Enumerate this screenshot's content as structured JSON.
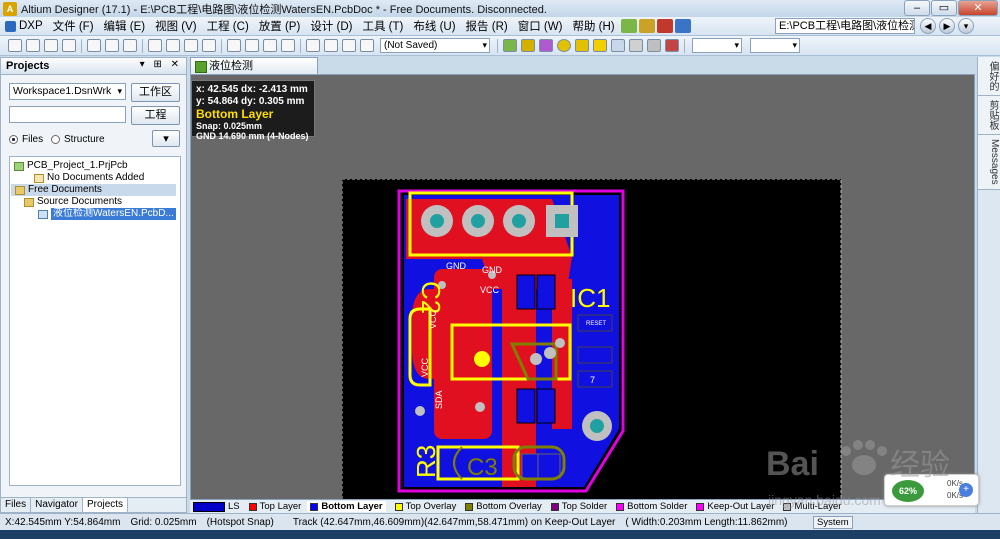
{
  "window": {
    "title": "Altium Designer (17.1) - E:\\PCB工程\\电路图\\液位检测WatersEN.PcbDoc * - Free Documents. Disconnected.",
    "path": "E:\\PCB工程\\电路图\\液位检测Wat"
  },
  "menu": [
    "DXP",
    "文件 (F)",
    "编辑 (E)",
    "视图 (V)",
    "工程 (C)",
    "放置 (P)",
    "设计 (D)",
    "工具 (T)",
    "布线 (U)",
    "报告 (R)",
    "窗口 (W)",
    "帮助 (H)"
  ],
  "toolbar": {
    "saved_combo": "(Not Saved)"
  },
  "projects_panel": {
    "title": "Projects",
    "workspace": "Workspace1.DsnWrk",
    "workspace_btn": "工作区",
    "project_btn": "工程",
    "radio_files": "Files",
    "radio_structure": "Structure",
    "tree": {
      "project": "PCB_Project_1.PrjPcb",
      "no_docs": "No Documents Added",
      "free_docs": "Free Documents",
      "source_docs": "Source Documents",
      "pcb_doc": "液位检测WatersEN.PcbD..."
    },
    "tabs": [
      "Files",
      "Navigator",
      "Projects"
    ]
  },
  "document_tab": "液位检测WatersEN.PcbDoc *",
  "hud": {
    "line1": "x: 42.545   dx: -2.413 mm",
    "line2": "y: 54.864   dy:  0.305 mm",
    "layer": "Bottom Layer",
    "snap": "Snap: 0.025mm",
    "net": "GND   14.690 mm  (4-Nodes)"
  },
  "right_dock": [
    "偏好的",
    "剪贴板",
    "Messages"
  ],
  "layers": [
    {
      "name": "LS",
      "color": "#0000c8"
    },
    {
      "name": "Top Layer",
      "color": "#ff0000"
    },
    {
      "name": "Bottom Layer",
      "color": "#0000ff"
    },
    {
      "name": "Top Overlay",
      "color": "#ffff00"
    },
    {
      "name": "Bottom Overlay",
      "color": "#808000"
    },
    {
      "name": "Top Solder",
      "color": "#800080"
    },
    {
      "name": "Bottom Solder",
      "color": "#ff00ff"
    },
    {
      "name": "Keep-Out Layer",
      "color": "#ff00ff"
    },
    {
      "name": "Multi-Layer",
      "color": "#c0c0c0"
    }
  ],
  "status": {
    "coords": "X:42.545mm Y:54.864mm",
    "grid": "Grid: 0.025mm",
    "snap": "(Hotspot Snap)",
    "track": "Track (42.647mm,46.609mm)(42.647mm,58.471mm) on Keep-Out Layer",
    "width": "( Width:0.203mm Length:11.862mm)",
    "system": "System"
  },
  "net_widget": {
    "pct": "62%",
    "up": "0K/s",
    "down": "0K/s"
  },
  "pcb": {
    "label_c2": "C2",
    "label_ic1": "IC1",
    "label_r3": "R3",
    "label_c3": "C3",
    "labels": [
      "GND",
      "VCC",
      "GND",
      "RESET",
      "SDA",
      "VCC",
      "VCC",
      "SCL",
      "VCC",
      "7",
      "SDA"
    ]
  }
}
